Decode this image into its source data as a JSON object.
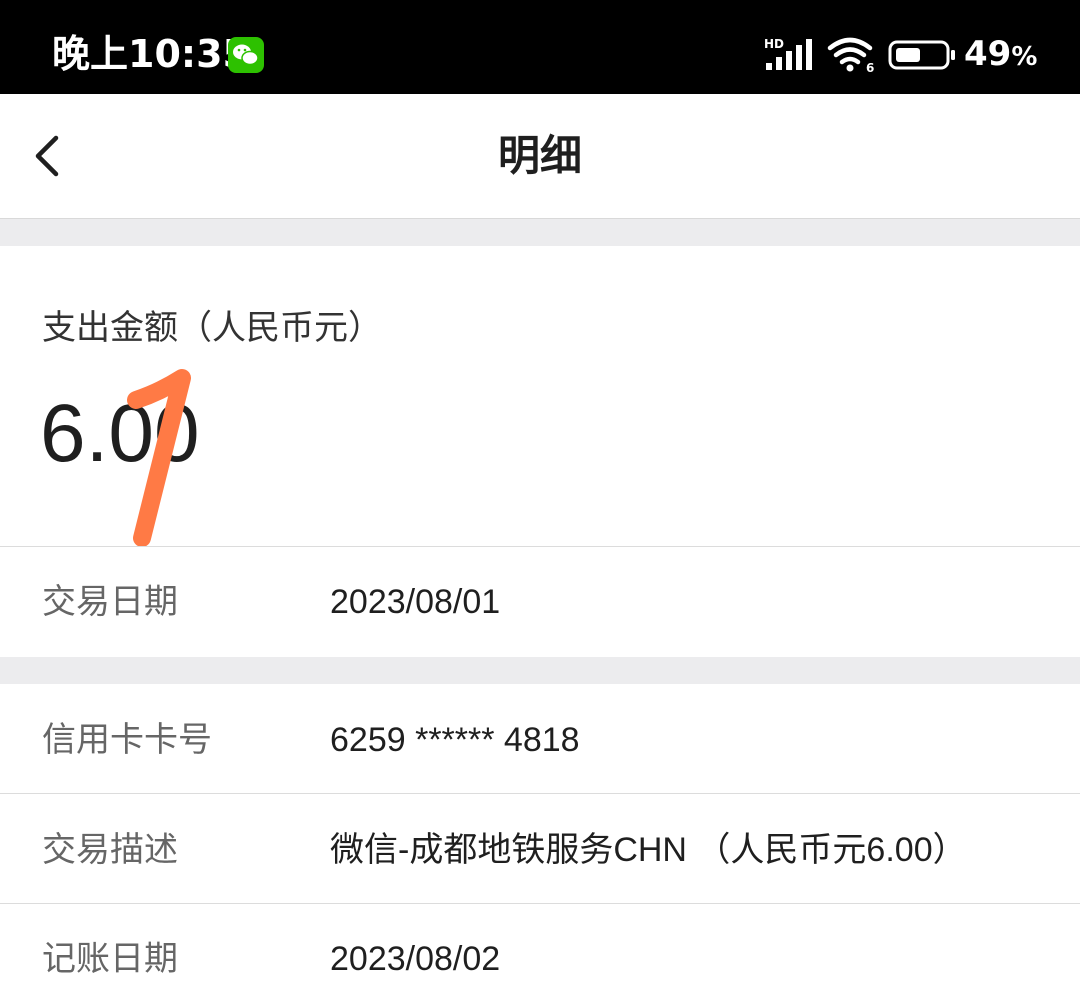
{
  "status_bar": {
    "time": "晚上10:35",
    "battery": "49",
    "battery_sign": "%",
    "network_label": "HD",
    "wifi_sub": "6",
    "icons": [
      "wechat-icon",
      "signal-icon",
      "wifi-icon",
      "battery-icon"
    ]
  },
  "nav": {
    "title": "明细",
    "back_icon": "chevron-left-icon"
  },
  "amount": {
    "label": "支出金额（人民币元）",
    "value": "6.00"
  },
  "details": {
    "transaction_date": {
      "label": "交易日期",
      "value": "2023/08/01"
    },
    "card_number": {
      "label": "信用卡卡号",
      "value": "6259 ****** 4818"
    },
    "description": {
      "label": "交易描述",
      "value": "微信-成都地铁服务CHN （人民币元6.00）"
    },
    "posting_date": {
      "label": "记账日期",
      "value": "2023/08/02"
    }
  },
  "colors": {
    "status_bar_bg": "#000000",
    "page_bg": "#ffffff",
    "gap_bg": "#ececee",
    "scribble": "#ff7a45",
    "wechat_green": "#2dc100"
  }
}
